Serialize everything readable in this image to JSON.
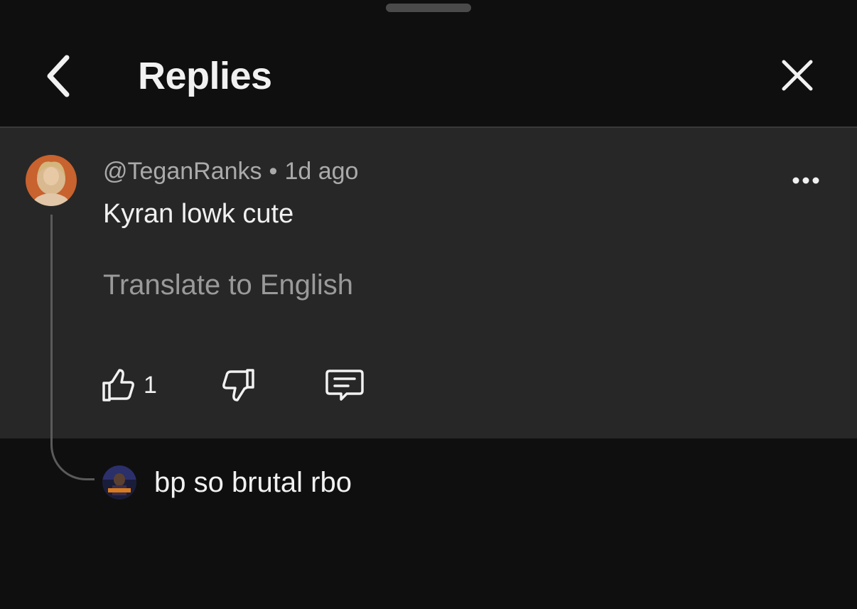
{
  "header": {
    "title": "Replies",
    "back_icon": "chevron-left-icon",
    "close_icon": "close-icon"
  },
  "comment": {
    "author": "@TeganRanks",
    "separator": "•",
    "time": "1d ago",
    "text": "Kyran lowk cute",
    "translate_label": "Translate to English",
    "like_count": "1",
    "more_icon": "more-horizontal-icon",
    "like_icon": "thumbs-up-icon",
    "dislike_icon": "thumbs-down-icon",
    "reply_icon": "reply-comment-icon"
  },
  "reply": {
    "text": "bp so brutal rbo"
  },
  "colors": {
    "background": "#0f0f0f",
    "card": "#272727",
    "text_primary": "#f1f1f1",
    "text_secondary": "#aaaaaa"
  }
}
